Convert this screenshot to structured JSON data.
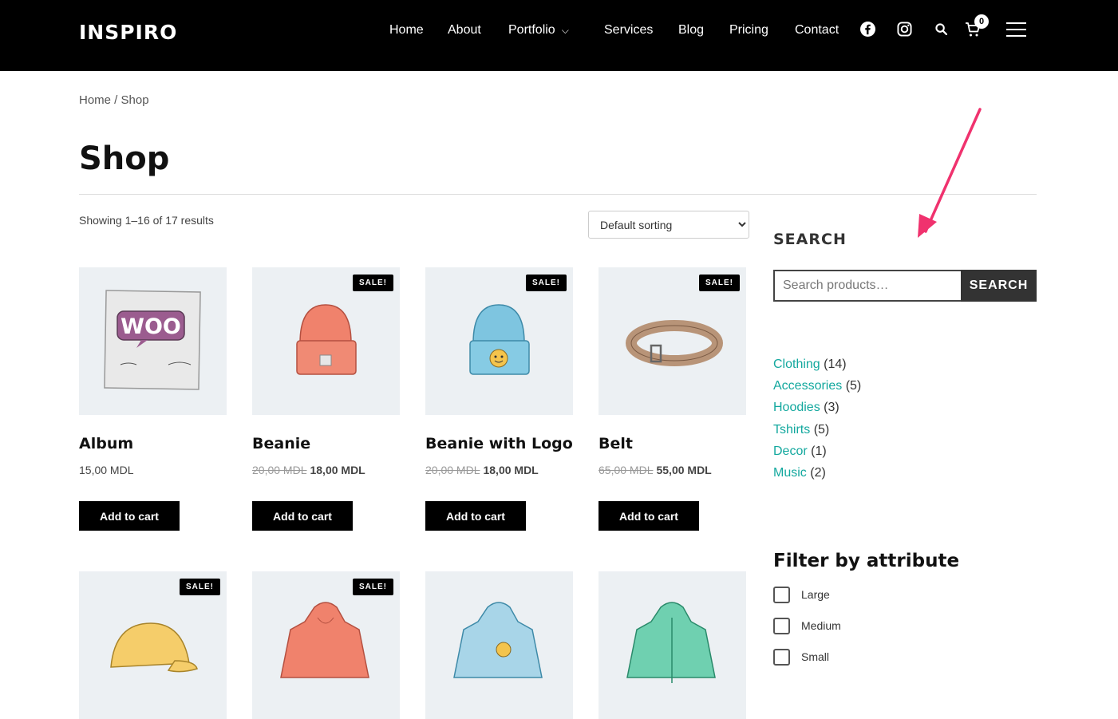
{
  "header": {
    "logo": "INSPIRO",
    "nav": [
      "Home",
      "About",
      "Portfolio",
      "Services",
      "Blog",
      "Pricing",
      "Contact"
    ],
    "cart_count": "0",
    "icons": [
      "facebook-icon",
      "instagram-icon",
      "search-icon",
      "cart-icon",
      "menu-icon"
    ]
  },
  "breadcrumb": {
    "home": "Home",
    "sep": " / ",
    "current": "Shop"
  },
  "page_title": "Shop",
  "toolbar": {
    "result_count": "Showing 1–16 of 17 results",
    "sort_selected": "Default sorting"
  },
  "products": [
    {
      "name": "Album",
      "price": "15,00 MDL",
      "old_price": "",
      "sale": "",
      "button": "Add to cart"
    },
    {
      "name": "Beanie",
      "price": "18,00 MDL",
      "old_price": "20,00 MDL",
      "sale": "SALE!",
      "button": "Add to cart"
    },
    {
      "name": "Beanie with Logo",
      "price": "18,00 MDL",
      "old_price": "20,00 MDL",
      "sale": "SALE!",
      "button": "Add to cart"
    },
    {
      "name": "Belt",
      "price": "55,00 MDL",
      "old_price": "65,00 MDL",
      "sale": "SALE!",
      "button": "Add to cart"
    },
    {
      "sale": "SALE!"
    },
    {
      "sale": "SALE!"
    },
    {
      "sale": ""
    },
    {
      "sale": ""
    }
  ],
  "sidebar": {
    "search_heading": "SEARCH",
    "search_placeholder": "Search products…",
    "search_button": "SEARCH",
    "categories": [
      {
        "name": "Clothing",
        "count": "(14)"
      },
      {
        "name": "Accessories",
        "count": "(5)"
      },
      {
        "name": "Hoodies",
        "count": "(3)"
      },
      {
        "name": "Tshirts",
        "count": "(5)"
      },
      {
        "name": "Decor",
        "count": "(1)"
      },
      {
        "name": "Music",
        "count": "(2)"
      }
    ],
    "filter_title": "Filter by attribute",
    "filters": [
      "Large",
      "Medium",
      "Small"
    ]
  },
  "colors": {
    "accent": "#13a89e",
    "arrow": "#f0326e",
    "header_bg": "#000000"
  }
}
